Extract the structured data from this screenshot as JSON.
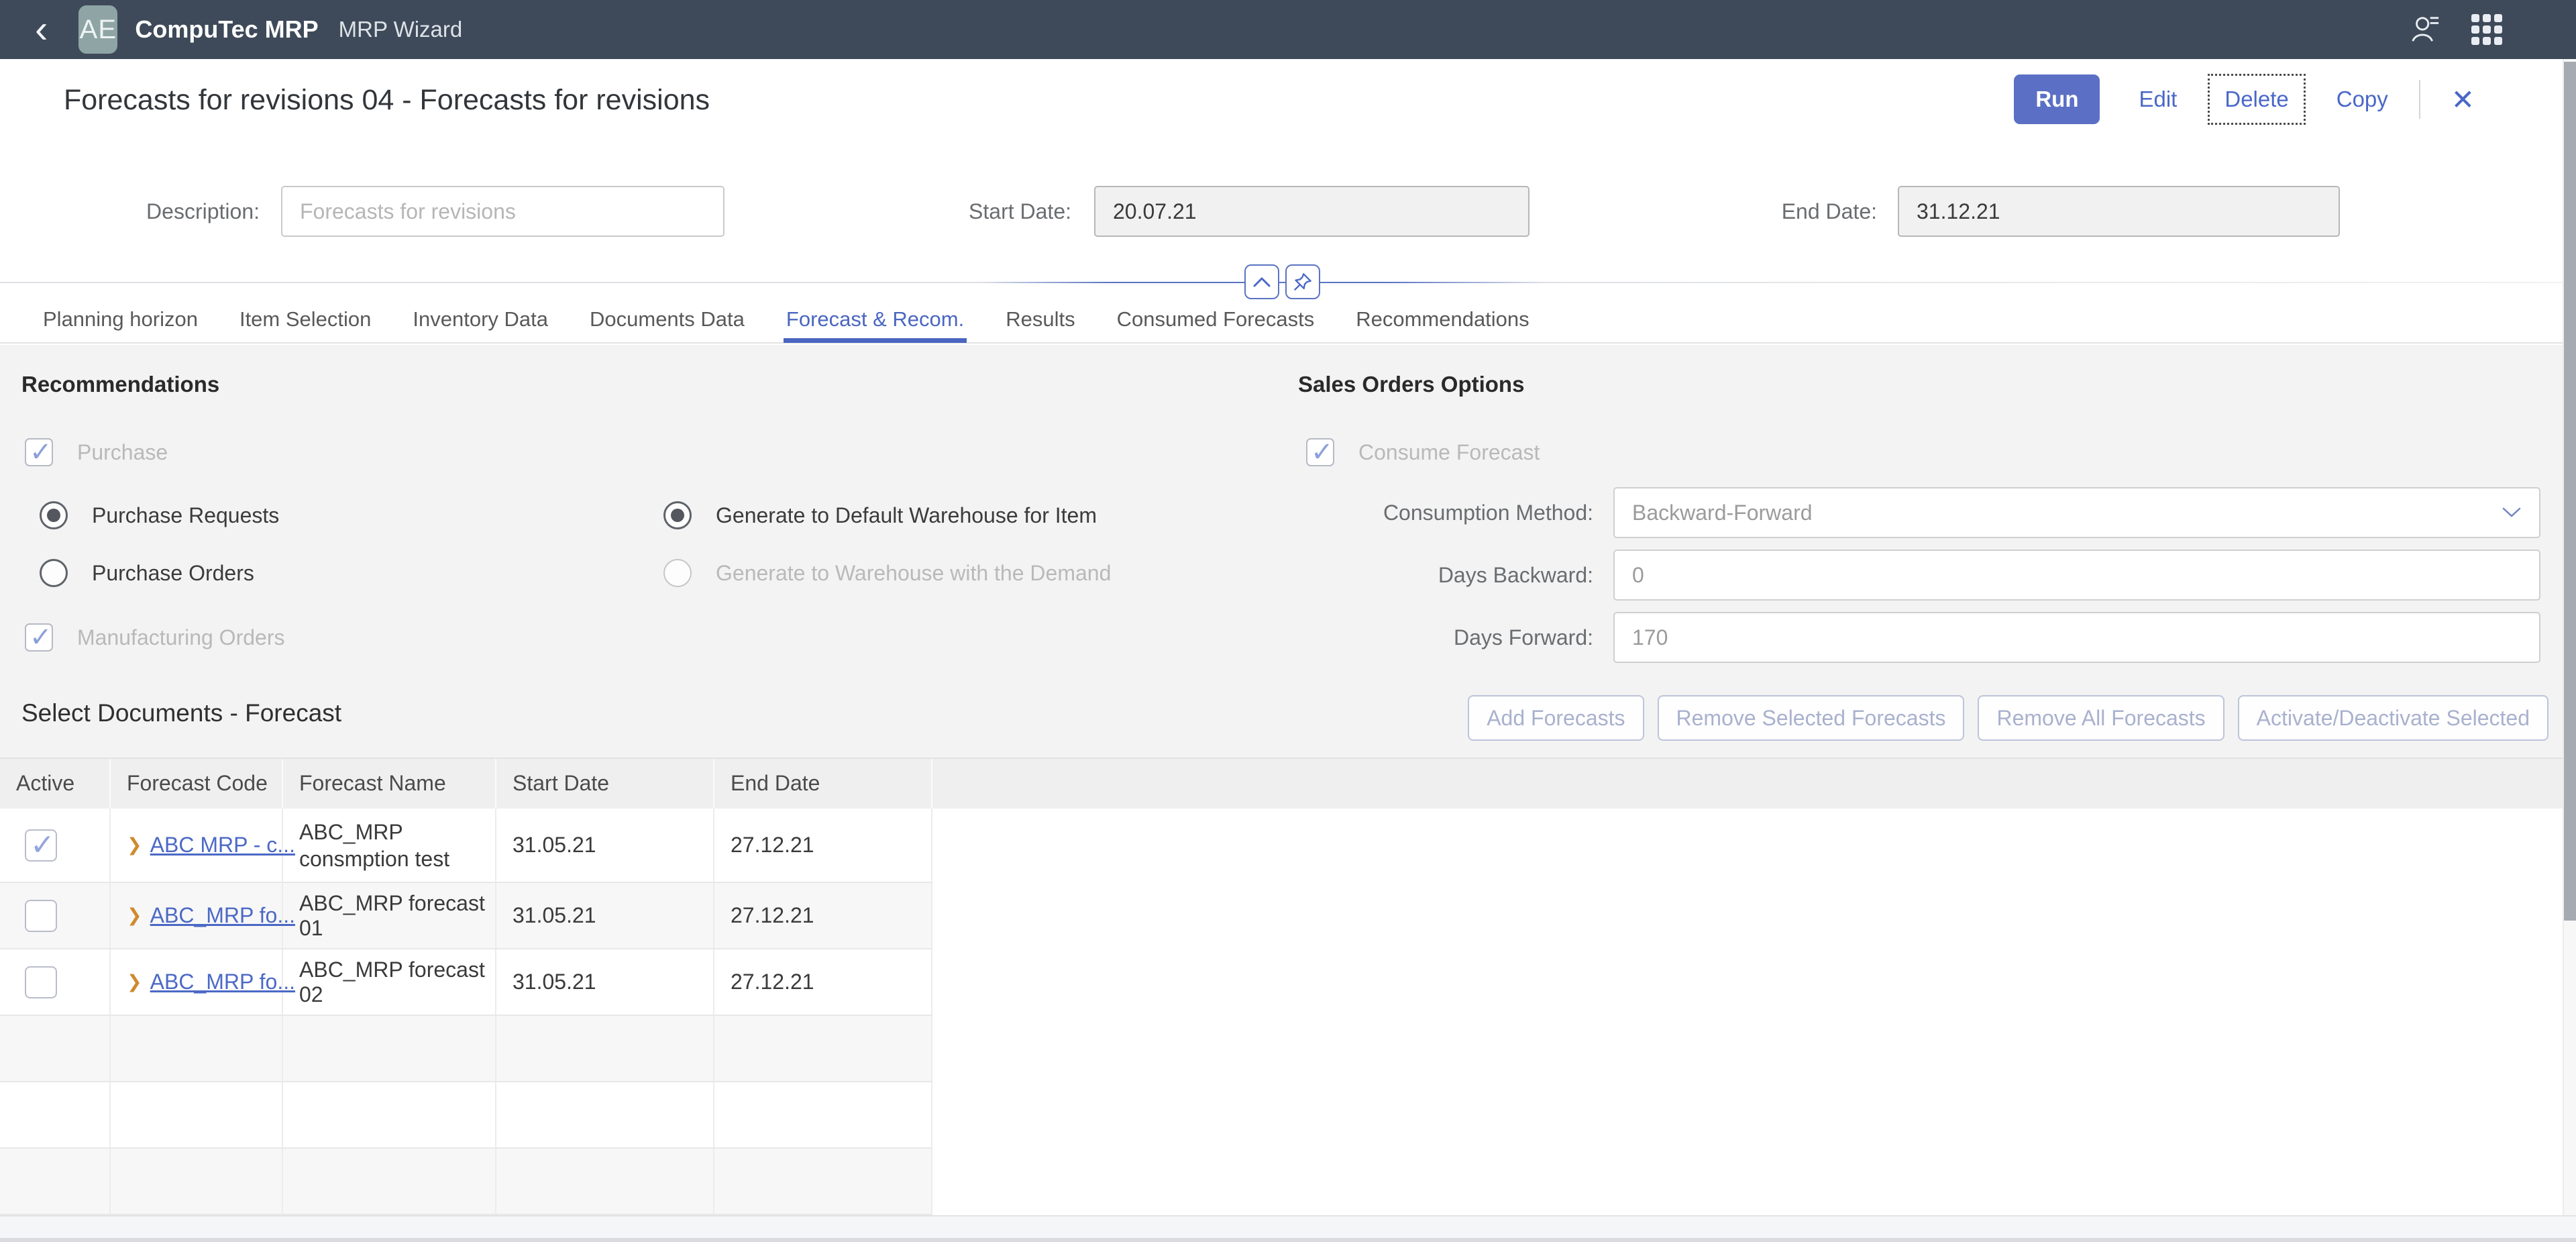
{
  "shellbar": {
    "logo_text": "AE",
    "app_title": "CompuTec MRP",
    "app_subtitle": "MRP Wizard"
  },
  "header": {
    "title": "Forecasts for revisions 04 - Forecasts for revisions",
    "run": "Run",
    "edit": "Edit",
    "delete": "Delete",
    "copy": "Copy"
  },
  "form": {
    "description_label": "Description:",
    "description_placeholder": "Forecasts for revisions",
    "start_date_label": "Start Date:",
    "start_date_value": "20.07.21",
    "end_date_label": "End Date:",
    "end_date_value": "31.12.21"
  },
  "tabs": [
    {
      "label": "Planning horizon",
      "active": false
    },
    {
      "label": "Item Selection",
      "active": false
    },
    {
      "label": "Inventory Data",
      "active": false
    },
    {
      "label": "Documents Data",
      "active": false
    },
    {
      "label": "Forecast & Recom.",
      "active": true
    },
    {
      "label": "Results",
      "active": false
    },
    {
      "label": "Consumed Forecasts",
      "active": false
    },
    {
      "label": "Recommendations",
      "active": false
    }
  ],
  "recommendations": {
    "heading": "Recommendations",
    "purchase_label": "Purchase",
    "purchase_checked": true,
    "purchase_requests_label": "Purchase Requests",
    "purchase_requests_selected": true,
    "purchase_orders_label": "Purchase Orders",
    "purchase_orders_selected": false,
    "manufacturing_orders_label": "Manufacturing Orders",
    "manufacturing_orders_checked": true,
    "generate_default_label": "Generate to Default Warehouse for Item",
    "generate_default_selected": true,
    "generate_demand_label": "Generate to Warehouse with the Demand",
    "generate_demand_selected": false
  },
  "sales_orders": {
    "heading": "Sales Orders Options",
    "consume_forecast_label": "Consume Forecast",
    "consume_forecast_checked": true,
    "consumption_method_label": "Consumption Method:",
    "consumption_method_value": "Backward-Forward",
    "days_backward_label": "Days Backward:",
    "days_backward_value": "0",
    "days_forward_label": "Days Forward:",
    "days_forward_value": "170"
  },
  "documents": {
    "heading": "Select Documents - Forecast",
    "add_button": "Add Forecasts",
    "remove_selected_button": "Remove Selected Forecasts",
    "remove_all_button": "Remove All Forecasts",
    "activate_button": "Activate/Deactivate Selected",
    "columns": [
      "Active",
      "Forecast Code",
      "Forecast Name",
      "Start Date",
      "End Date"
    ],
    "rows": [
      {
        "active": true,
        "code": "ABC MRP - c...",
        "name": "ABC_MRP consmption test",
        "start_date": "31.05.21",
        "end_date": "27.12.21"
      },
      {
        "active": false,
        "code": "ABC_MRP fo...",
        "name": "ABC_MRP forecast 01",
        "start_date": "31.05.21",
        "end_date": "27.12.21"
      },
      {
        "active": false,
        "code": "ABC_MRP fo...",
        "name": "ABC_MRP forecast 02",
        "start_date": "31.05.21",
        "end_date": "27.12.21"
      }
    ],
    "empty_row_count": 3
  },
  "icons": {
    "back": "‹",
    "user": "person-with-menu",
    "apps": "grid-3x3",
    "collapse": "chevron-up",
    "pin": "pushpin",
    "close": "✕",
    "select_chevron": "chevron-down",
    "row_link_chevron": "❯",
    "check": "✓"
  },
  "colors": {
    "shellbar_bg": "#3e4a59",
    "logo_tile_bg": "#8fa5a5",
    "accent_blue": "#4a67c8",
    "run_button_bg": "#5b70c5",
    "active_tab": "#4a66c0",
    "link_blue": "#4b69c5",
    "link_chevron_orange": "#cf8b2d",
    "section_bg": "#f3f3f3",
    "table_header_bg": "#efefef",
    "zebra_row_bg": "#f7f7f7",
    "disabled_text": "#b9b9b9",
    "check_disabled": "#8b9fd9"
  }
}
